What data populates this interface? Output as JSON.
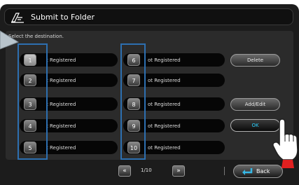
{
  "window": {
    "title": "Submit to Folder",
    "title_icon": "folder-submit-icon"
  },
  "prompt": "Select the destination.",
  "left_column": [
    {
      "number": "1",
      "label": "t Registered",
      "selected": true
    },
    {
      "number": "2",
      "label": "t Registered",
      "selected": false
    },
    {
      "number": "3",
      "label": "t Registered",
      "selected": false
    },
    {
      "number": "4",
      "label": "t Registered",
      "selected": false
    },
    {
      "number": "5",
      "label": "t Registered",
      "selected": false
    }
  ],
  "right_column": [
    {
      "number": "6",
      "label": "ot Registered"
    },
    {
      "number": "7",
      "label": "ot Registered"
    },
    {
      "number": "8",
      "label": "ot Registered"
    },
    {
      "number": "9",
      "label": "ot Registered"
    },
    {
      "number": "10",
      "label": "ot Registered"
    }
  ],
  "actions": {
    "delete": "Delete",
    "add_edit": "Add/Edit",
    "ok": "OK"
  },
  "footer": {
    "prev": "«",
    "page": "1/10",
    "next": "»",
    "back": "Back"
  },
  "colors": {
    "highlight": "#2d6fb0",
    "ok_text": "#2ad0ff",
    "back_arrow": "#36b8e6"
  }
}
